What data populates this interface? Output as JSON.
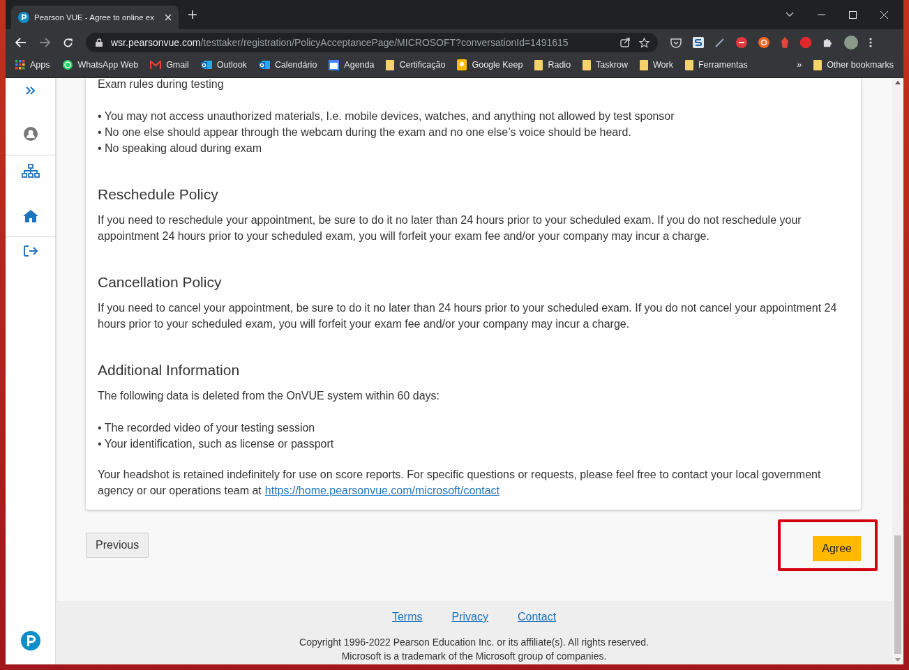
{
  "browser": {
    "tab": {
      "title": "Pearson VUE - Agree to online ex"
    },
    "url": {
      "host": "wsr.pearsonvue.com",
      "path": "/testtaker/registration/PolicyAcceptancePage/MICROSOFT?conversationId=1491615"
    },
    "bookmarks": [
      {
        "label": "Apps",
        "kind": "apps"
      },
      {
        "label": "WhatsApp Web",
        "kind": "whatsapp"
      },
      {
        "label": "Gmail",
        "kind": "gmail"
      },
      {
        "label": "Outlook",
        "kind": "outlook"
      },
      {
        "label": "Calendário",
        "kind": "outlook"
      },
      {
        "label": "Agenda",
        "kind": "calendar"
      },
      {
        "label": "Certificação",
        "kind": "folder"
      },
      {
        "label": "Google Keep",
        "kind": "keep"
      },
      {
        "label": "Radio",
        "kind": "folder"
      },
      {
        "label": "Taskrow",
        "kind": "folder"
      },
      {
        "label": "Work",
        "kind": "folder"
      },
      {
        "label": "Ferramentas",
        "kind": "folder"
      }
    ],
    "overflow": "»",
    "other_bookmarks": "Other bookmarks"
  },
  "policy": {
    "blocks": [
      {
        "kind": "paragraph",
        "text": "Exam rules during testing"
      },
      {
        "kind": "bullets",
        "items": [
          "• You may not access unauthorized materials, I.e. mobile devices, watches, and anything not allowed by test sponsor",
          "• No one else should appear through the webcam during the exam and no one else’s voice should be heard.",
          "• No speaking aloud during exam"
        ]
      },
      {
        "kind": "heading",
        "text": "Reschedule Policy"
      },
      {
        "kind": "paragraph",
        "text": "If you need to reschedule your appointment, be sure to do it no later than 24 hours prior to your scheduled exam. If you do not reschedule your appointment 24 hours prior to your scheduled exam, you will forfeit your exam fee and/or your company may incur a charge."
      },
      {
        "kind": "heading",
        "text": "Cancellation Policy"
      },
      {
        "kind": "paragraph",
        "text": "If you need to cancel your appointment, be sure to do it no later than 24 hours prior to your scheduled exam. If you do not cancel your appointment 24 hours prior to your scheduled exam, you will forfeit your exam fee and/or your company may incur a charge."
      },
      {
        "kind": "heading",
        "text": "Additional Information"
      },
      {
        "kind": "paragraph",
        "text": "The following data is deleted from the OnVUE system within 60 days:"
      },
      {
        "kind": "bullets",
        "items": [
          "• The recorded video of your testing session",
          "• Your identification, such as license or passport"
        ]
      },
      {
        "kind": "paragraph",
        "text": "Your headshot is retained indefinitely for use on score reports. For specific questions or requests, please feel free to contact your local government agency or our operations team at",
        "link": "https://home.pearsonvue.com/microsoft/contact"
      }
    ]
  },
  "buttons": {
    "previous": "Previous",
    "agree": "Agree"
  },
  "footer": {
    "links": [
      "Terms",
      "Privacy",
      "Contact"
    ],
    "copyright": "Copyright 1996-2022 Pearson Education Inc. or its affiliate(s). All rights reserved.",
    "trademark": "Microsoft is a trademark of the Microsoft group of companies."
  }
}
